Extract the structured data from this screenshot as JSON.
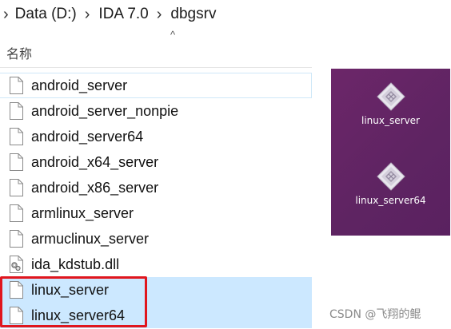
{
  "breadcrumb": {
    "items": [
      "Data (D:)",
      "IDA 7.0",
      "dbgsrv"
    ]
  },
  "list": {
    "column_name": "名称",
    "sort_indicator": "^",
    "files": [
      {
        "name": "android_server",
        "icon": "blank-file-icon",
        "selected": false
      },
      {
        "name": "android_server_nonpie",
        "icon": "blank-file-icon",
        "selected": false
      },
      {
        "name": "android_server64",
        "icon": "blank-file-icon",
        "selected": false
      },
      {
        "name": "android_x64_server",
        "icon": "blank-file-icon",
        "selected": false
      },
      {
        "name": "android_x86_server",
        "icon": "blank-file-icon",
        "selected": false
      },
      {
        "name": "armlinux_server",
        "icon": "blank-file-icon",
        "selected": false
      },
      {
        "name": "armuclinux_server",
        "icon": "blank-file-icon",
        "selected": false
      },
      {
        "name": "ida_kdstub.dll",
        "icon": "dll-file-icon",
        "selected": false
      },
      {
        "name": "linux_server",
        "icon": "blank-file-icon",
        "selected": true
      },
      {
        "name": "linux_server64",
        "icon": "blank-file-icon",
        "selected": true
      }
    ]
  },
  "desktop": {
    "items": [
      {
        "label": "linux_server",
        "icon": "executable-diamond-icon"
      },
      {
        "label": "linux_server64",
        "icon": "executable-diamond-icon"
      }
    ]
  },
  "watermark": "CSDN @飞翔的鲲",
  "colors": {
    "highlight": "#e0161e",
    "selection": "#cce8ff",
    "desktop_bg": "#6c2669"
  }
}
